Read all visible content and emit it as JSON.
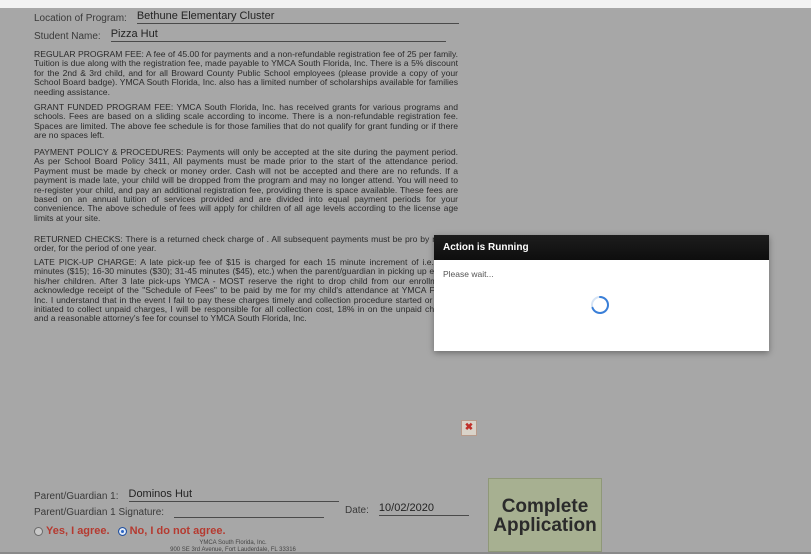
{
  "form": {
    "location_label": "Location of Program:",
    "location_value": "Bethune Elementary Cluster",
    "student_label": "Student Name:",
    "student_value": "Pizza Hut",
    "paragraphs": [
      "REGULAR PROGRAM FEE: A fee of 45.00 for payments and a non-refundable registration fee of 25 per family. Tuition is due along with the registration fee, made payable to YMCA South Florida, Inc. There is a 5% discount for the 2nd & 3rd child, and for all Broward County Public School employees (please provide a copy of your School Board badge). YMCA South Florida, Inc. also has a limited number of scholarships available for families needing assistance.",
      "GRANT FUNDED PROGRAM FEE: YMCA South Florida, Inc. has received grants for various programs and schools. Fees are based on a sliding scale according to income. There is a non-refundable registration fee. Spaces are limited. The above fee schedule is for those families that do not qualify for grant funding or if there are no spaces left.",
      "PAYMENT POLICY & PROCEDURES: Payments will only be accepted at the site during the payment period. As per School Board Policy 3411, All payments must be made prior to the start of the attendance period. Payment must be made by check or money order. Cash will not be accepted and there are no refunds. If a payment is made late, your child will be dropped from the program and may no longer attend. You will need to re-register your child, and pay an additional registration fee, providing there is space available. These fees are based on an annual tuition of services provided and are divided into equal payment periods for your convenience. The above schedule of fees will apply for children of all age levels according to the license age limits at your site.",
      "RETURNED CHECKS: There is a returned check charge of . All subsequent payments must be pro by money order, for the period of one year.",
      "LATE PICK-UP CHARGE: A late pick-up fee of $15 is charged for each 15 minute increment of i.e. (1-15 minutes ($15); 16-30 minutes ($30); 31-45 minutes ($45), etc.) when the parent/guardian in picking up each of his/her children. After 3 late pick-ups YMCA - MOST reserve the right to drop child from our enrollment. I acknowledge receipt of the \"Schedule of Fees\" to be paid by me for my child's attendance at YMCA Florida, Inc. I understand that in the event I fail to pay these charges timely and collection procedure started or suit is initiated to collect unpaid charges, I will be responsible for all collection cost, 18% in on the unpaid charges, and a reasonable attorney's fee for counsel to YMCA South Florida, Inc."
    ],
    "parent_label": "Parent/Guardian 1:",
    "parent_value": "Dominos Hut",
    "signature_label": "Parent/Guardian 1 Signature:",
    "date_label": "Date:",
    "date_value": "10/02/2020",
    "agree_yes": "Yes, I agree.",
    "agree_no": "No, I do not agree.",
    "agree_selected": "no",
    "complete_line1": "Complete",
    "complete_line2": "Application",
    "footer_line1": "YMCA South Florida, Inc.",
    "footer_line2": "900 SE 3rd Avenue, Fort Lauderdale, FL 33316"
  },
  "modal": {
    "title": "Action is Running",
    "message": "Please wait..."
  },
  "icons": {
    "close": "close-icon",
    "spinner": "loading-spinner-icon"
  },
  "colors": {
    "modal_header": "#111111",
    "spinner": "#3a7fd8",
    "complete_button": "#a7b091",
    "agree_text": "#b53a30"
  }
}
